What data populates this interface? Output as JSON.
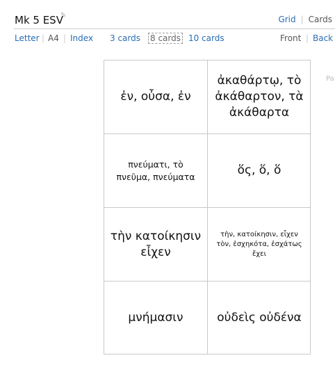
{
  "header": {
    "title": "Mk 5 ESV",
    "nav": {
      "grid": "Grid",
      "separator": "|",
      "cards": "Cards"
    }
  },
  "toolbar": {
    "letter": "Letter",
    "a4": "A4",
    "index": "Index",
    "three_cards": "3 cards",
    "eight_cards": "8 cards",
    "ten_cards": "10 cards",
    "front": "Front",
    "back": "Back",
    "separator": "|"
  },
  "cards": [
    {
      "text": "ἐν, οὖσα, ἐν"
    },
    {
      "text": "ἀκαθάρτῳ, τὸ ἀκάθαρτον, τὰ ἀκάθαρτα"
    },
    {
      "text": "πνεύματι, τὸ πνεῦμα, πνεύματα"
    },
    {
      "text": "ὅς, ὅ, ὅ"
    },
    {
      "text": "τὴν κατοίκησιν εἶχεν"
    },
    {
      "text": "τὴν, κατοίκησιν, εἶχεν τὸν, ἐσχηκότα, ἐσχάτως ἔχει"
    },
    {
      "text": "μνήμασιν"
    },
    {
      "text": "οὐδεὶς οὐδένα"
    }
  ],
  "side_label": "Pa"
}
